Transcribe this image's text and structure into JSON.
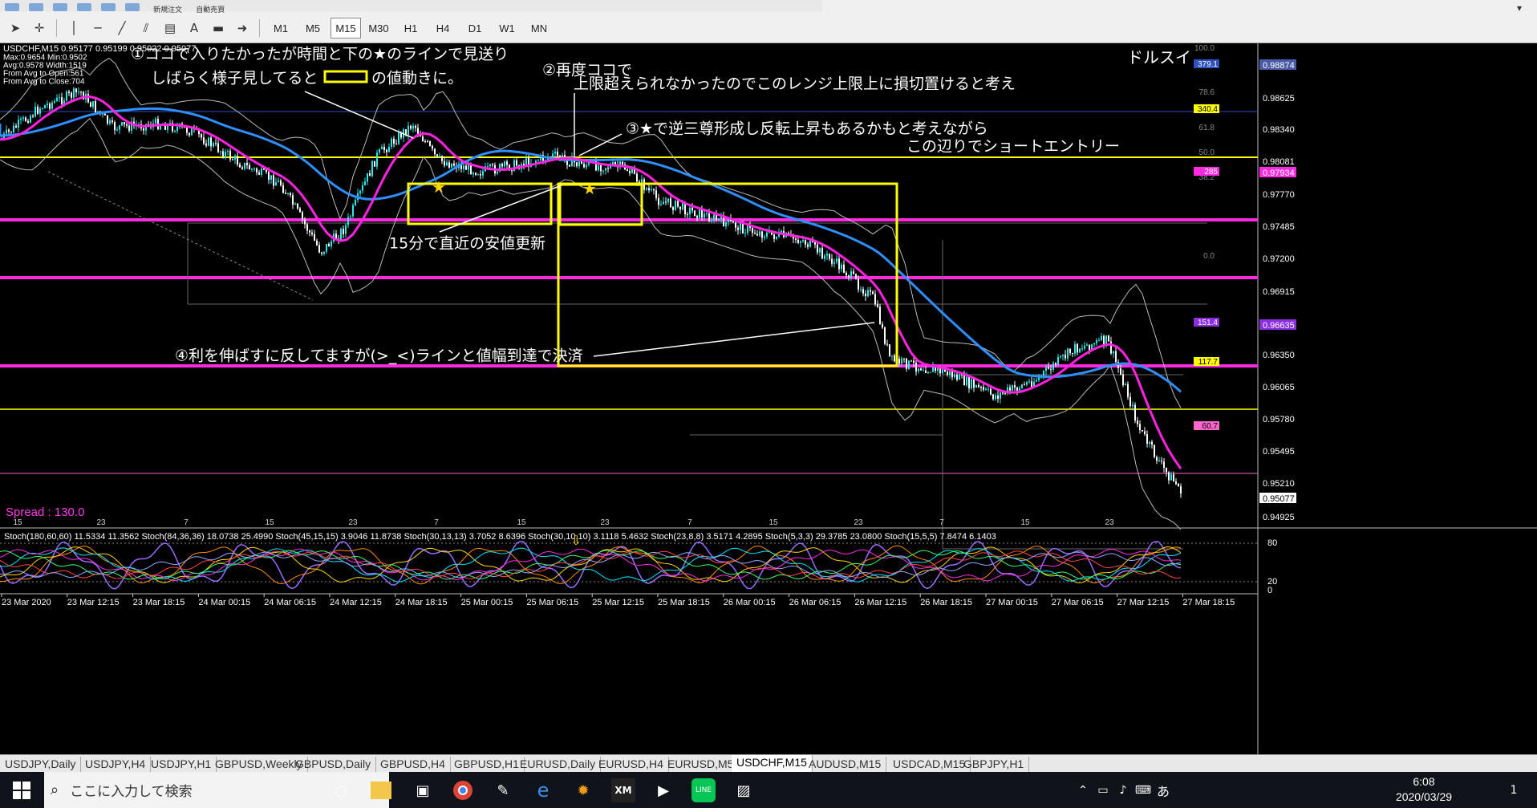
{
  "toolbar": {
    "new_order": "新規注文",
    "auto_trade": "自動売買",
    "timeframes": [
      "M1",
      "M5",
      "M15",
      "M30",
      "H1",
      "H4",
      "D1",
      "W1",
      "MN"
    ],
    "active_timeframe": "M15"
  },
  "chart": {
    "symbol_line": "USDCHF,M15  0.95177 0.95199 0.95022 0.95077",
    "info_lines": [
      "Max:0.9654 Min:0.9502",
      "Avg:0.9578 Width:1519",
      "From Avg to Open:561",
      "From Avg to Close:704"
    ],
    "corner_label": "ドルスイ",
    "spread": "Spread : 130.0",
    "price_ticks": [
      "0.98874",
      "0.98625",
      "0.98340",
      "0.98081",
      "0.97934",
      "0.97770",
      "0.97485",
      "0.97200",
      "0.96915",
      "0.96635",
      "0.96350",
      "0.96065",
      "0.95780",
      "0.95495",
      "0.95210",
      "0.95077",
      "0.94925"
    ],
    "price_tag_colors": {
      "0.98874": "#4a5aa8",
      "0.98481": "#ffff00",
      "0.97934": "#ff2ae0",
      "0.96635": "#8a2ee0",
      "0.96247": "#ffff00",
      "0.95684": "#ff66cc",
      "0.95077": "#ffffff"
    },
    "line_labels": [
      "379.1",
      "340.4",
      "285",
      "151.4",
      "117.7",
      "60.7"
    ],
    "fib_labels": [
      "100.0",
      "78.6",
      "61.8",
      "50.0",
      "38.2",
      "0.0"
    ],
    "date_ticks_top": [
      "15",
      "23",
      "7",
      "15",
      "23",
      "7",
      "15",
      "23",
      "7",
      "15",
      "23",
      "7",
      "15",
      "23"
    ],
    "date_axis": [
      "23 Mar 2020",
      "23 Mar 12:15",
      "23 Mar 18:15",
      "24 Mar 00:15",
      "24 Mar 06:15",
      "24 Mar 12:15",
      "24 Mar 18:15",
      "25 Mar 00:15",
      "25 Mar 06:15",
      "25 Mar 12:15",
      "25 Mar 18:15",
      "26 Mar 00:15",
      "26 Mar 06:15",
      "26 Mar 12:15",
      "26 Mar 18:15",
      "27 Mar 00:15",
      "27 Mar 06:15",
      "27 Mar 12:15",
      "27 Mar 18:15"
    ],
    "stoch_header": "Stoch(180,60,60) 11.5334 11.3562  Stoch(84,36,36) 18.0738 25.4990  Stoch(45,15,15) 3.9046 11.8738  Stoch(30,13,13) 3.7052 8.6396  Stoch(30,10,10) 3.1118 5.4632  Stoch(23,8,8) 3.5171 4.2895  Stoch(5,3,3) 29.3785 23.0800  Stoch(15,5,5) 7.8474 6.1403",
    "stoch_levels": [
      "80",
      "20",
      "0"
    ],
    "annotations": {
      "a1_line1": "①ココで入りたかったが時間と下の★のラインで見送り",
      "a1_line2": "しばらく様子見してると",
      "a1_line2b": "の値動きに。",
      "a2_line1": "②再度ココで",
      "a2_line2": "上限超えられなかったのでこのレンジ上限上に損切置けると考え",
      "a3_line1": "③★で逆三尊形成し反転上昇もあるかもと考えながら",
      "a3_line2": "この辺りでショートエントリー",
      "a_mid": "15分で直近の安値更新",
      "a4": "④利を伸ばすに反してますが(>_<)ラインと値幅到達で決済"
    }
  },
  "tabs": [
    "USDJPY,Daily",
    "USDJPY,H4",
    "USDJPY,H1",
    "GBPUSD,Weekly",
    "GBPUSD,Daily",
    "GBPUSD,H4",
    "GBPUSD,H1",
    "EURUSD,Daily",
    "EURUSD,H4",
    "EURUSD,M5",
    "USDCHF,M15",
    "AUDUSD,M15",
    "USDCAD,M15",
    "GBPJPY,H1"
  ],
  "active_tab": "USDCHF,M15",
  "taskbar": {
    "search_placeholder": "ここに入力して検索",
    "time": "6:08",
    "date": "2020/03/29",
    "ime": "あ",
    "notifications": "1"
  }
}
